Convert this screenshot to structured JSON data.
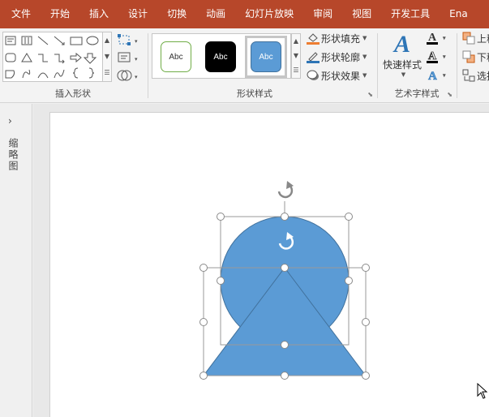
{
  "menu": {
    "items": [
      "文件",
      "开始",
      "插入",
      "设计",
      "切换",
      "动画",
      "幻灯片放映",
      "审阅",
      "视图",
      "开发工具",
      "Ena"
    ]
  },
  "ribbon": {
    "insert_shapes": {
      "label": "插入形状"
    },
    "shape_styles": {
      "label": "形状样式",
      "chips": [
        {
          "text": "Abc",
          "fill": "#ffffff",
          "border": "#70ad47",
          "color": "#333333"
        },
        {
          "text": "Abc",
          "fill": "#000000",
          "border": "#000000",
          "color": "#ffffff"
        },
        {
          "text": "Abc",
          "fill": "#5b9bd5",
          "border": "#41719c",
          "color": "#ffffff"
        }
      ],
      "fill": "形状填充",
      "outline": "形状轮廓",
      "effects": "形状效果"
    },
    "wordart": {
      "label": "艺术字样式",
      "quick": "快速样式"
    },
    "arrange": {
      "forward": "上移",
      "backward": "下移",
      "select": "选择"
    }
  },
  "left_pane": {
    "label": "缩略图"
  },
  "colors": {
    "accent": "#b7472a",
    "shape_fill": "#5b9bd5",
    "shape_stroke": "#41719c"
  }
}
